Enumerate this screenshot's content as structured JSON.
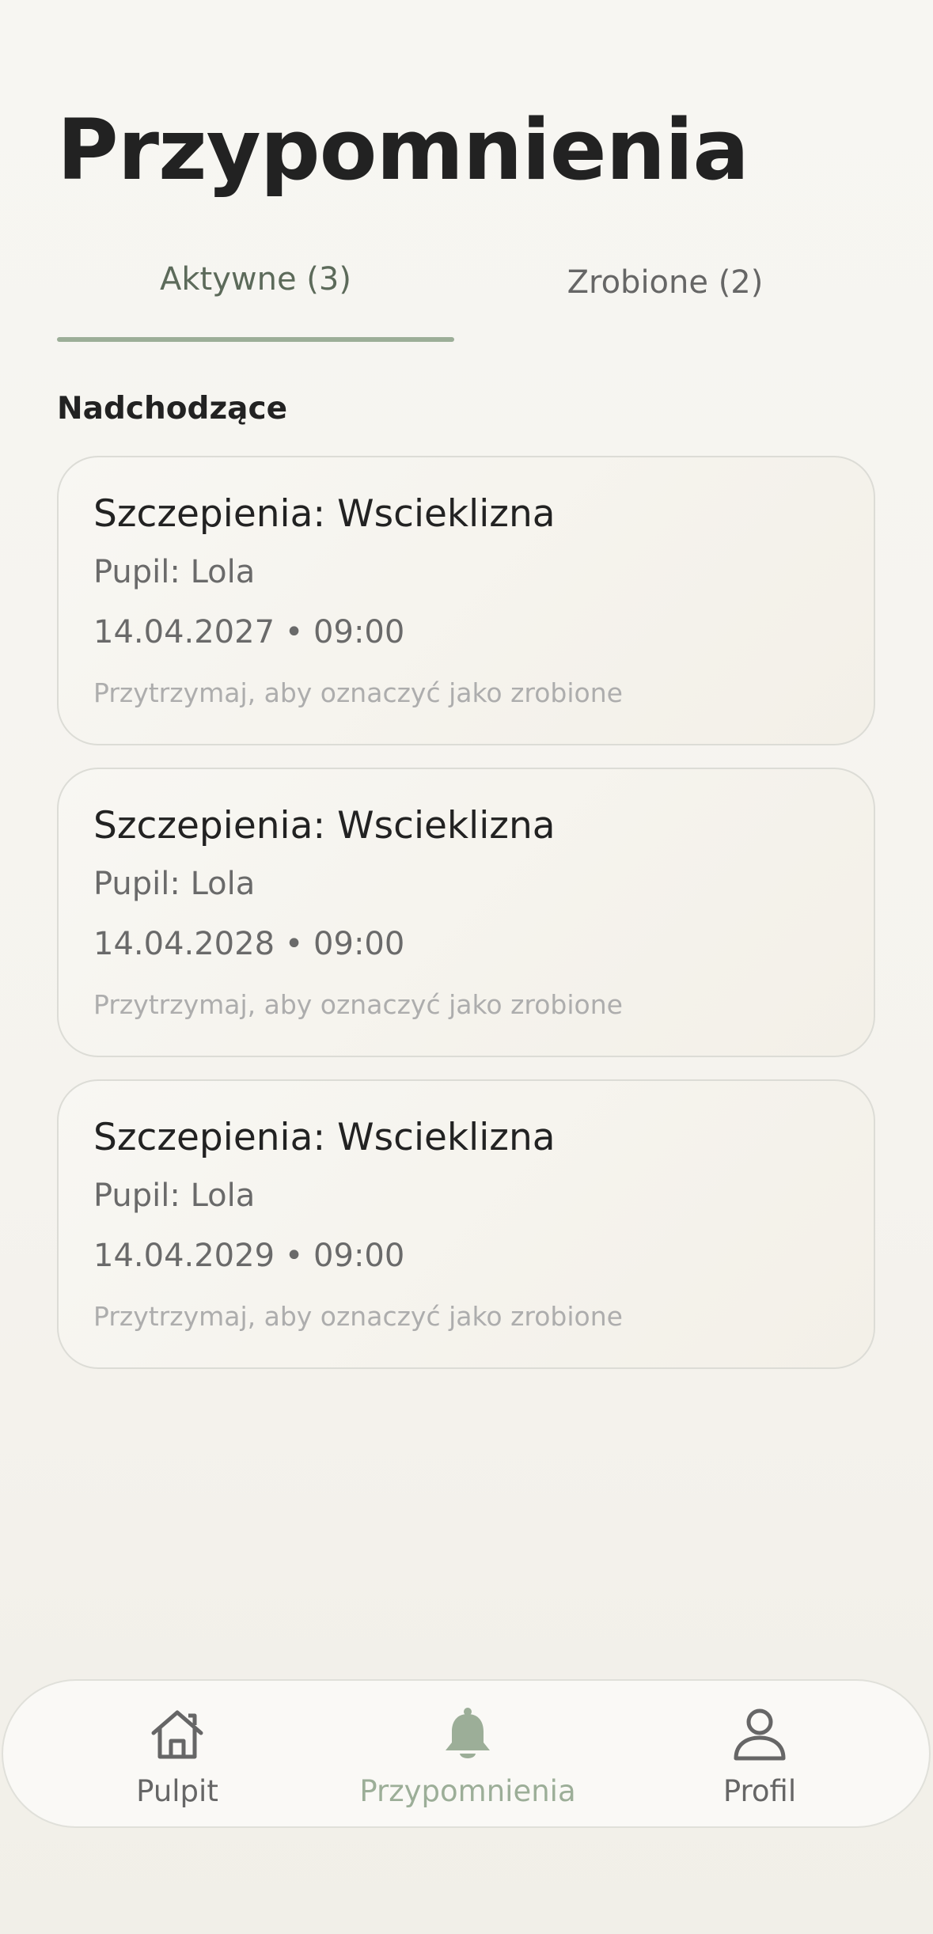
{
  "page": {
    "title": "Przypomnienia"
  },
  "tabs": [
    {
      "label": "Aktywne (3)"
    },
    {
      "label": "Zrobione (2)"
    }
  ],
  "section": {
    "label": "Nadchodzące"
  },
  "reminders": [
    {
      "title": "Szczepienia: Wscieklizna",
      "pet": "Pupil: Lola",
      "datetime": "14.04.2027 • 09:00",
      "hint": "Przytrzymaj, aby oznaczyć jako zrobione"
    },
    {
      "title": "Szczepienia: Wscieklizna",
      "pet": "Pupil: Lola",
      "datetime": "14.04.2028 • 09:00",
      "hint": "Przytrzymaj, aby oznaczyć jako zrobione"
    },
    {
      "title": "Szczepienia: Wscieklizna",
      "pet": "Pupil: Lola",
      "datetime": "14.04.2029 • 09:00",
      "hint": "Przytrzymaj, aby oznaczyć jako zrobione"
    }
  ],
  "nav": [
    {
      "label": "Pulpit",
      "icon": "home-icon"
    },
    {
      "label": "Przypomnienia",
      "icon": "bell-icon"
    },
    {
      "label": "Profil",
      "icon": "user-icon"
    }
  ],
  "colors": {
    "accent": "#9cae98",
    "text": "#222222",
    "muted": "#6a6a6a",
    "hint": "#adadad"
  }
}
